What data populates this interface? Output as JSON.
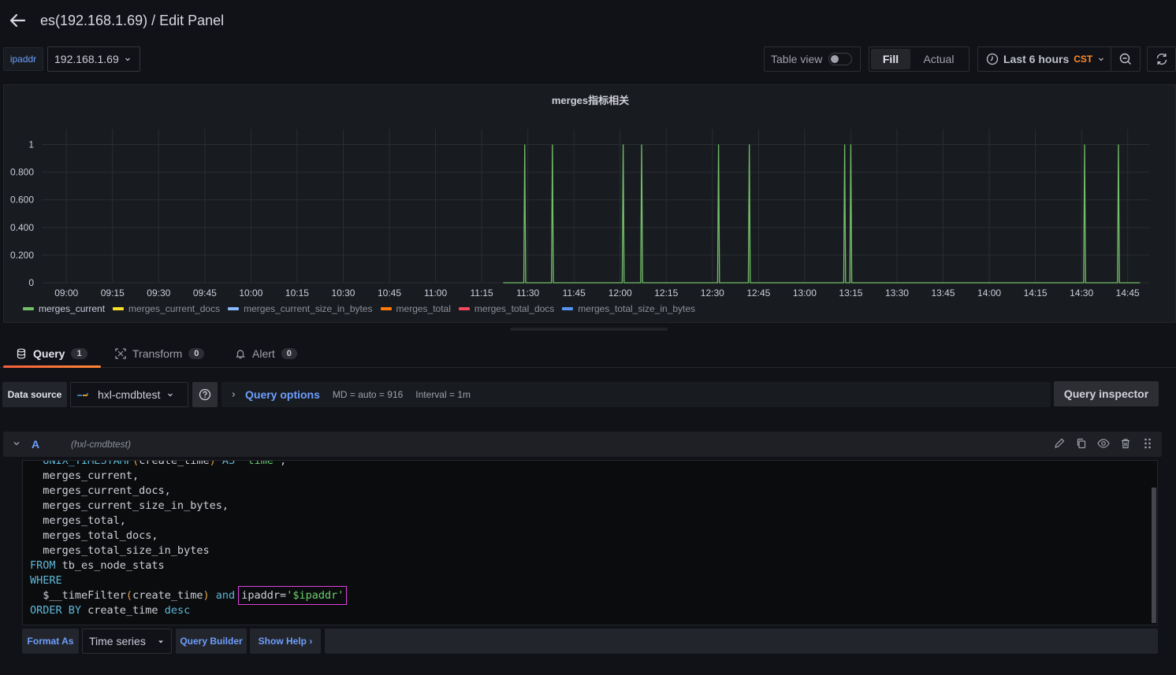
{
  "header": {
    "title": "es(192.168.1.69) / Edit Panel",
    "back_icon": "arrow-left-icon"
  },
  "variables": {
    "label": "ipaddr",
    "value": "192.168.1.69"
  },
  "toolbar": {
    "table_view_label": "Table view",
    "table_view_on": false,
    "fill_label": "Fill",
    "actual_label": "Actual",
    "selected_mode": "Fill",
    "time_range": "Last 6 hours",
    "timezone": "CST"
  },
  "panel": {
    "title": "merges指标相关"
  },
  "chart_data": {
    "type": "line",
    "title": "merges指标相关",
    "xlabel": "",
    "ylabel": "",
    "x_range": [
      "08:52",
      "14:52"
    ],
    "ylim": [
      0,
      1.1
    ],
    "grid": true,
    "legend_position": "bottom-left",
    "x_ticks": [
      "09:00",
      "09:15",
      "09:30",
      "09:45",
      "10:00",
      "10:15",
      "10:30",
      "10:45",
      "11:00",
      "11:15",
      "11:30",
      "11:45",
      "12:00",
      "12:15",
      "12:30",
      "12:45",
      "13:00",
      "13:15",
      "13:30",
      "13:45",
      "14:00",
      "14:15",
      "14:30",
      "14:45"
    ],
    "y_ticks": [
      "0",
      "0.200",
      "0.400",
      "0.600",
      "0.800",
      "1"
    ],
    "y_tick_values": [
      0,
      0.2,
      0.4,
      0.6,
      0.8,
      1
    ],
    "series": [
      {
        "name": "merges_current",
        "color": "#73bf69",
        "start": "11:22",
        "end": "14:49",
        "baseline": 0,
        "spikes": [
          "11:29",
          "11:38",
          "12:01",
          "12:07",
          "12:32",
          "12:42",
          "13:13",
          "13:15",
          "14:31",
          "14:42"
        ],
        "spike_value": 1
      },
      {
        "name": "merges_current_docs",
        "color": "#fade2a",
        "values": []
      },
      {
        "name": "merges_current_size_in_bytes",
        "color": "#8ab8ff",
        "values": []
      },
      {
        "name": "merges_total",
        "color": "#ff780a",
        "values": []
      },
      {
        "name": "merges_total_docs",
        "color": "#f2495c",
        "values": []
      },
      {
        "name": "merges_total_size_in_bytes",
        "color": "#5794f2",
        "values": []
      }
    ]
  },
  "tabs": [
    {
      "label": "Query",
      "count": "1",
      "active": true,
      "icon": "database-icon"
    },
    {
      "label": "Transform",
      "count": "0",
      "active": false,
      "icon": "transform-icon"
    },
    {
      "label": "Alert",
      "count": "0",
      "active": false,
      "icon": "bell-icon"
    }
  ],
  "query_bar": {
    "datasource_label": "Data source",
    "datasource_value": "hxl-cmdbtest",
    "query_options_label": "Query options",
    "md": "MD = auto = 916",
    "interval": "Interval = 1m",
    "inspector_label": "Query inspector"
  },
  "query": {
    "ref_id": "A",
    "datasource": "(hxl-cmdbtest)",
    "sql_lines": [
      "  UNIX_TIMESTAMP(create_time) AS \"time\",",
      "  merges_current,",
      "  merges_current_docs,",
      "  merges_current_size_in_bytes,",
      "  merges_total,",
      "  merges_total_docs,",
      "  merges_total_size_in_bytes",
      "FROM tb_es_node_stats",
      "WHERE",
      "  $__timeFilter(create_time) and ipaddr='$ipaddr'",
      "ORDER BY create_time desc"
    ]
  },
  "footer": {
    "format_as_label": "Format As",
    "format_value": "Time series",
    "query_builder_label": "Query Builder",
    "show_help_label": "Show Help ›"
  }
}
